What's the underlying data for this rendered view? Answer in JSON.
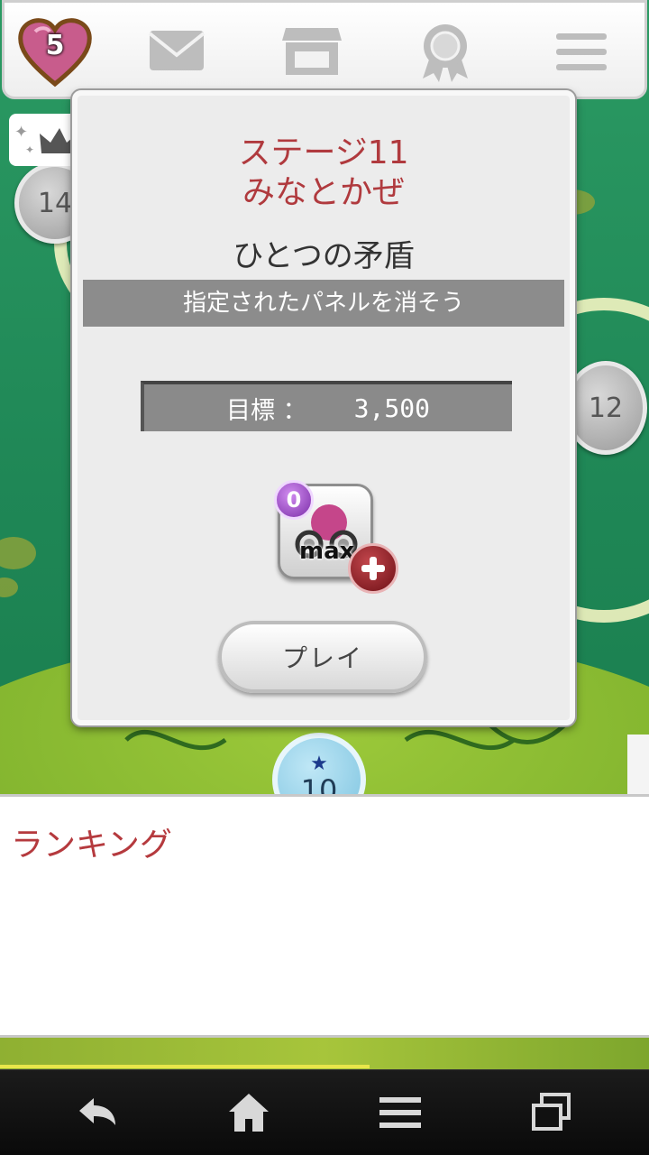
{
  "header": {
    "lives": "5",
    "icons": [
      "heart-icon",
      "mail-icon",
      "shop-icon",
      "award-icon",
      "menu-icon"
    ]
  },
  "map": {
    "nodes": [
      {
        "label": "14",
        "state": "locked"
      },
      {
        "label": "12",
        "state": "locked"
      },
      {
        "label": "10",
        "state": "current"
      }
    ]
  },
  "popup": {
    "stage_number": "ステージ11",
    "stage_name": "みなとかぜ",
    "subtitle": "ひとつの矛盾",
    "mission": "指定されたパネルを消そう",
    "target_label": "目標 ：",
    "target_value": "3,500",
    "item": {
      "count": "0",
      "label": "max"
    },
    "play_label": "プレイ"
  },
  "ranking": {
    "title": "ランキング"
  },
  "navbar": {
    "icons": [
      "back-icon",
      "home-icon",
      "menu-icon",
      "windows-icon"
    ]
  },
  "colors": {
    "accent_red": "#b03a3e",
    "background_green": "#1f8756",
    "popup_bg": "#ececec"
  }
}
